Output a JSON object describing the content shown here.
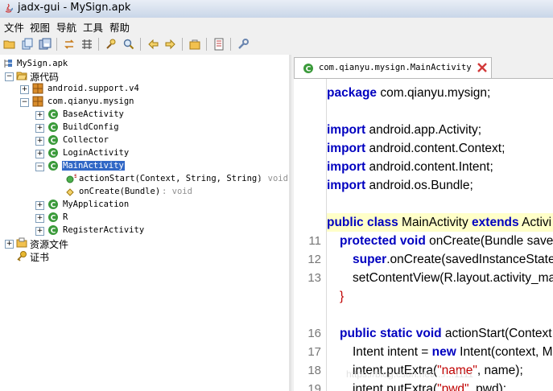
{
  "window": {
    "title": "jadx-gui - MySign.apk"
  },
  "menu": [
    "文件",
    "视图",
    "导航",
    "工具",
    "帮助"
  ],
  "toolbar_icons": [
    "open-icon",
    "add-files-icon",
    "save-all-icon",
    "sync-icon",
    "flatten-icon",
    "search-icon",
    "find-class-icon",
    "back-icon",
    "forward-icon",
    "decompile-icon",
    "log-icon",
    "preferences-icon"
  ],
  "tree": {
    "root": "MySign.apk",
    "sources": "源代码",
    "pkg_android": "android.support.v4",
    "pkg_app": "com.qianyu.mysign",
    "classes": [
      "BaseActivity",
      "BuildConfig",
      "Collector",
      "LoginActivity",
      "MainActivity"
    ],
    "methods": [
      {
        "name": "actionStart(Context, String, String)",
        "type": ": void"
      },
      {
        "name": "onCreate(Bundle)",
        "type": ": void"
      }
    ],
    "classes_after": [
      "MyApplication",
      "R",
      "RegisterActivity"
    ],
    "resources": "资源文件",
    "certificate": "证书"
  },
  "editor": {
    "tab_title": "com.qianyu.mysign.MainActivity",
    "line_numbers": {
      "l11": "11",
      "l12": "12",
      "l13": "13",
      "l16": "16",
      "l17": "17",
      "l18": "18",
      "l19": "19"
    },
    "code": {
      "pkg_kw": "package",
      "pkg_name": " com.qianyu.mysign;",
      "import_kw": "import",
      "imp1": " android.app.Activity;",
      "imp2": " android.content.Context;",
      "imp3": " android.content.Intent;",
      "imp4": " android.os.Bundle;",
      "class_kw1": "public class",
      "class_name": " MainActivity ",
      "class_kw2": "extends",
      "class_rest": " Activi",
      "oc_kw": "protected void",
      "oc_rest": " onCreate(Bundle save",
      "super_kw": "super",
      "super_rest": ".onCreate(savedInstanceState",
      "setcv": "setContentView(R.layout.activity_ma",
      "brace": "}",
      "as_kw": "public static void",
      "as_rest": " actionStart(Context",
      "intent_a": "Intent intent = ",
      "new_kw": "new",
      "intent_b": " Intent(context, Ma",
      "put1_a": "intent.putExtra(",
      "put1_s": "\"name\"",
      "put1_b": ", name);",
      "put2_a": "intent.putExtra(",
      "put2_s": "\"pwd\"",
      "put2_b": ", pwd);"
    }
  },
  "watermark": "https://blog.csdn.net/.../...1111"
}
